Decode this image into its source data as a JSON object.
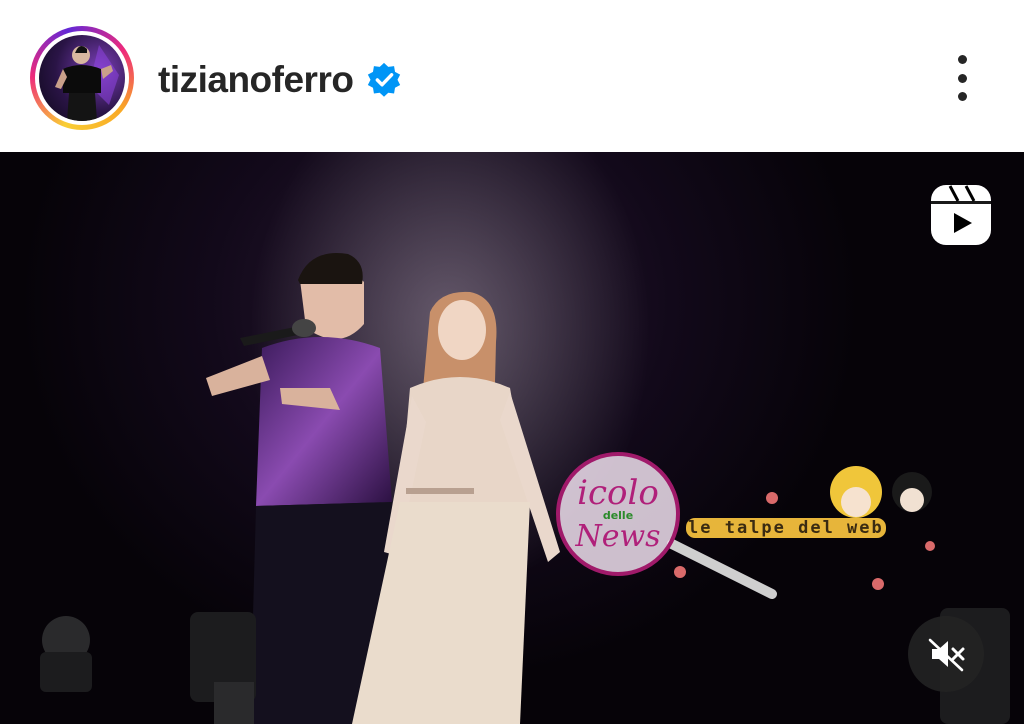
{
  "post": {
    "username": "tizianoferro",
    "verified": true,
    "avatar_icon": "profile-photo",
    "more_icon": "more-vertical-icon"
  },
  "media": {
    "type": "reel",
    "reels_icon": "reels-icon",
    "sound_muted": true,
    "sound_icon": "speaker-muted-icon",
    "watermark": {
      "line1": "icolo",
      "line2": "delle",
      "line3": "News",
      "caption": "le talpe del web"
    }
  },
  "colors": {
    "text": "#262626",
    "verified_blue": "#0095f6",
    "ring_yellow": "#f9ce34",
    "ring_pink": "#ee2a7b",
    "ring_purple": "#6228d7"
  }
}
